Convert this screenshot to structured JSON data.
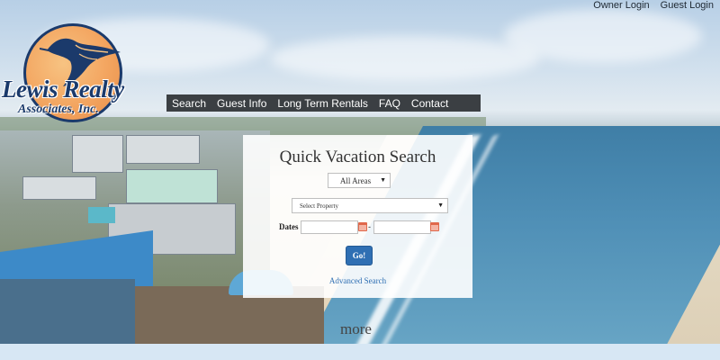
{
  "top_links": {
    "owner_login": "Owner Login",
    "guest_login": "Guest Login"
  },
  "logo": {
    "name": "Lewis Realty",
    "sub": "Associates, Inc."
  },
  "nav": {
    "items": [
      "Search",
      "Guest Info",
      "Long Term Rentals",
      "FAQ",
      "Contact"
    ]
  },
  "search": {
    "title": "Quick Vacation Search",
    "area_select": "All Areas",
    "property_select": "Select Property",
    "dates_label": "Dates :",
    "date_separator": "-",
    "go_label": "Go!",
    "advanced_link": "Advanced Search"
  },
  "more_link": "more",
  "colors": {
    "nav_bg": "#3b3f43",
    "button": "#2f6fb3",
    "logo_blue": "#1b3a6b",
    "logo_orange": "#f3a560"
  }
}
